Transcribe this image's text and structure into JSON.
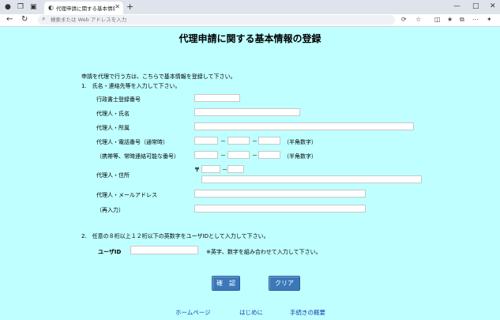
{
  "browser": {
    "tab_title": "代理申請に関する基本情報の登録",
    "new_tab": "+",
    "address_placeholder": "検索または Web アドレスを入力",
    "window": {
      "min": "—",
      "max": "□",
      "close": "✕"
    }
  },
  "page": {
    "title": "代理申請に関する基本情報の登録",
    "intro": "申請を代理で行う方は、こちらで基本情報を登録して下さい。",
    "section1": "1.　氏名・連絡先等を入力して下さい。",
    "labels": {
      "reg_no": "行政書士登録番号",
      "name": "代理人・氏名",
      "org": "代理人・所属",
      "phone": "代理人・電話番号（通常時）",
      "phone_alt": "（携帯等、常時連絡可能な番号）",
      "address": "代理人・住所",
      "email": "代理人・メールアドレス",
      "email_confirm": "（再入力）"
    },
    "halfwidth_note": "（半角数字）",
    "dash": "－",
    "postal_mark": "〒",
    "section2": "2.　任意の８桁以上１２桁以下の英数字をユーザIDとして入力して下さい。",
    "userid_label": "ユーザID",
    "userid_note": "※英字、数字を組み合わせて入力して下さい。",
    "buttons": {
      "confirm": "確　認",
      "clear": "クリア"
    },
    "footer_links": [
      "ホームページ",
      "はじめに",
      "手続きの概要"
    ]
  }
}
